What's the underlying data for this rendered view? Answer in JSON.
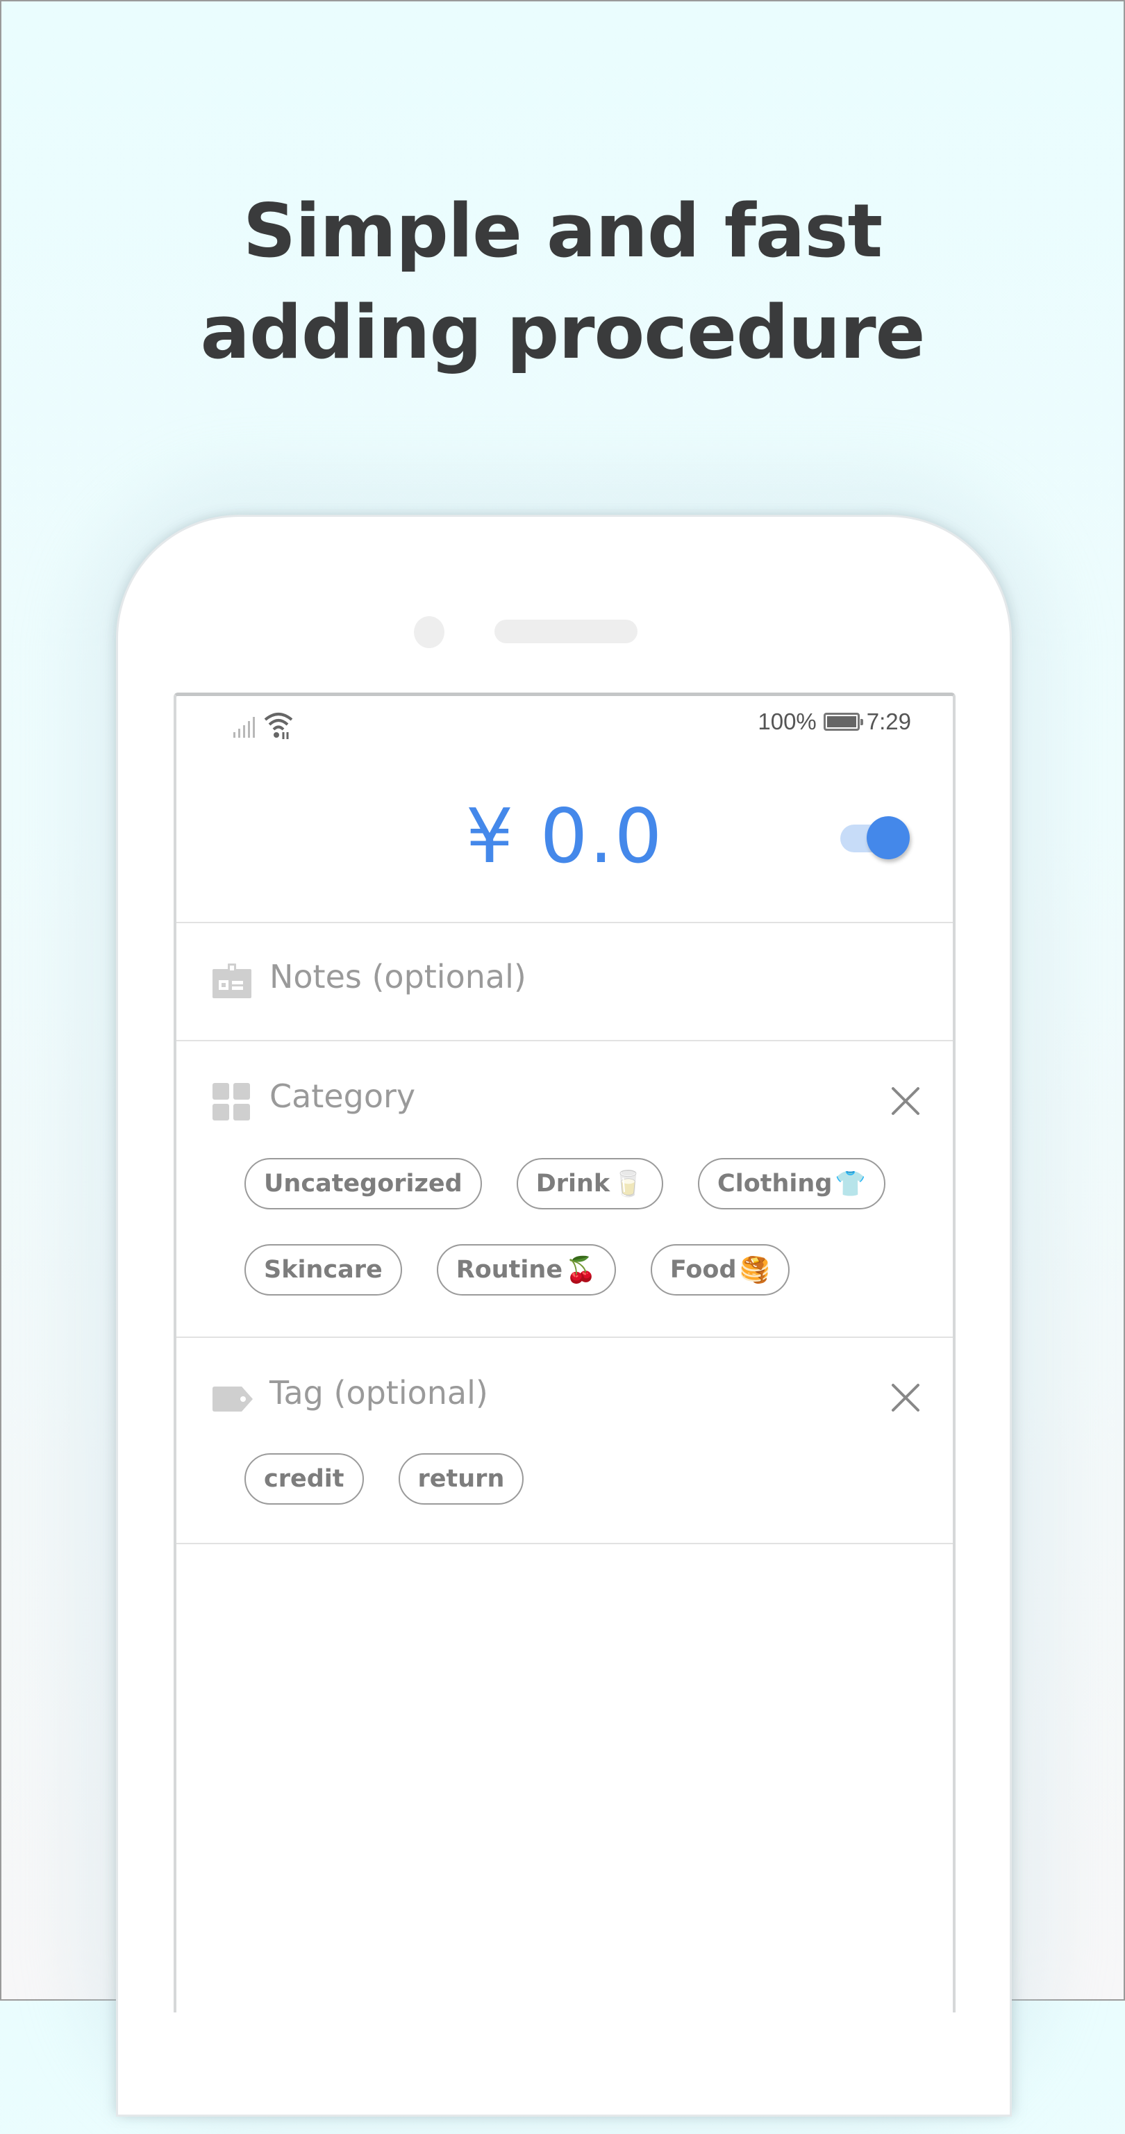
{
  "headline": {
    "line1": "Simple and fast",
    "line2": "adding procedure"
  },
  "status_bar": {
    "signal_icon": "signal-bars-icon",
    "wifi_icon": "wifi-icon",
    "battery_percent": "100%",
    "battery_icon": "battery-full-icon",
    "time": "7:29"
  },
  "amount": {
    "currency_symbol": "¥",
    "value": "0.0",
    "color": "#4488ea"
  },
  "toggle": {
    "state": "on",
    "color": "#4488ea"
  },
  "notes": {
    "icon": "id-card-icon",
    "placeholder": "Notes (optional)"
  },
  "category": {
    "icon": "grid-icon",
    "label": "Category",
    "close_icon": "close-icon",
    "chips": [
      {
        "label": "Uncategorized",
        "emoji": ""
      },
      {
        "label": "Drink",
        "emoji": "🥛"
      },
      {
        "label": "Clothing",
        "emoji": "👕"
      },
      {
        "label": "Skincare",
        "emoji": ""
      },
      {
        "label": "Routine",
        "emoji": "🍒"
      },
      {
        "label": "Food",
        "emoji": "🥞"
      }
    ]
  },
  "tag": {
    "icon": "tag-icon",
    "label": "Tag (optional)",
    "close_icon": "close-icon",
    "chips": [
      {
        "label": "credit"
      },
      {
        "label": "return"
      }
    ]
  }
}
